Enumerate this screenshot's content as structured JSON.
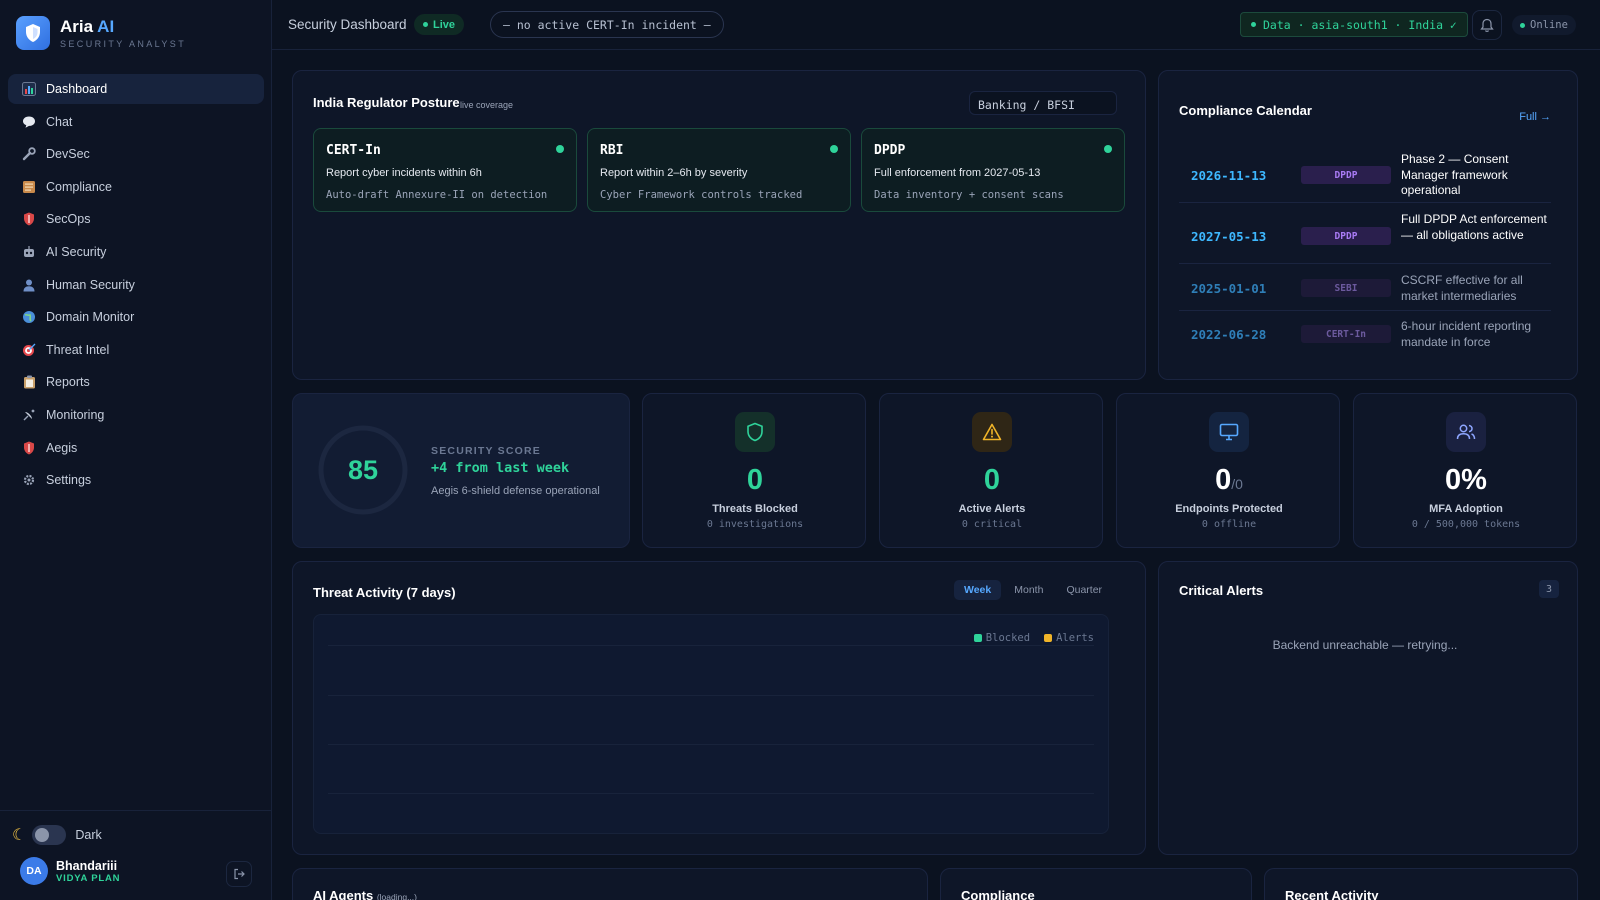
{
  "brand": {
    "name": "Aria",
    "name_accent": "AI",
    "subtitle": "SECURITY ANALYST"
  },
  "sidebar": {
    "items": [
      {
        "label": "Dashboard",
        "icon": "chart-icon",
        "active": true
      },
      {
        "label": "Chat",
        "icon": "speech-bubble-icon"
      },
      {
        "label": "DevSec",
        "icon": "wrench-icon"
      },
      {
        "label": "Compliance",
        "icon": "ledger-icon"
      },
      {
        "label": "SecOps",
        "icon": "shield-icon"
      },
      {
        "label": "AI Security",
        "icon": "robot-icon"
      },
      {
        "label": "Human Security",
        "icon": "person-icon"
      },
      {
        "label": "Domain Monitor",
        "icon": "globe-icon"
      },
      {
        "label": "Threat Intel",
        "icon": "target-icon"
      },
      {
        "label": "Reports",
        "icon": "clipboard-icon"
      },
      {
        "label": "Monitoring",
        "icon": "satellite-icon"
      },
      {
        "label": "Aegis",
        "icon": "shield-icon"
      },
      {
        "label": "Settings",
        "icon": "gear-icon"
      }
    ],
    "theme_label": "Dark",
    "user": {
      "initials": "DA",
      "name": "Bhandariii",
      "plan": "VIDYA PLAN"
    }
  },
  "topbar": {
    "title": "Security Dashboard",
    "live": "Live",
    "incident": "— no active CERT-In incident —",
    "region": "Data · asia-south1 · India ✓",
    "status": "Online"
  },
  "regulator": {
    "title": "India Regulator Posture",
    "subtitle": "live coverage",
    "sector": "Banking / BFSI",
    "tiles": [
      {
        "name": "CERT-In",
        "rule": "Report cyber incidents within 6h",
        "note": "Auto-draft Annexure-II on detection"
      },
      {
        "name": "RBI",
        "rule": "Report within 2–6h by severity",
        "note": "Cyber Framework controls tracked"
      },
      {
        "name": "DPDP",
        "rule": "Full enforcement from 2027-05-13",
        "note": "Data inventory + consent scans"
      }
    ]
  },
  "calendar": {
    "title": "Compliance Calendar",
    "full_link": "Full →",
    "rows": [
      {
        "date": "2026-11-13",
        "tag": "DPDP",
        "desc": "Phase 2 — Consent Manager framework operational",
        "upcoming": true
      },
      {
        "date": "2027-05-13",
        "tag": "DPDP",
        "desc": "Full DPDP Act enforcement — all obligations active",
        "upcoming": true
      },
      {
        "date": "2025-01-01",
        "tag": "SEBI",
        "desc": "CSCRF effective for all market intermediaries",
        "upcoming": false
      },
      {
        "date": "2022-06-28",
        "tag": "CERT-In",
        "desc": "6-hour incident reporting mandate in force",
        "upcoming": false
      }
    ]
  },
  "score": {
    "value": "85",
    "label": "SECURITY SCORE",
    "change": "+4 from last week",
    "note": "Aegis 6-shield defense operational",
    "fraction": 0.85
  },
  "stats": [
    {
      "value": "0",
      "label": "Threats Blocked",
      "sub": "0 investigations",
      "icon": "shield-check-icon",
      "color": "#2fd39a"
    },
    {
      "value": "0",
      "label": "Active Alerts",
      "sub": "0 critical",
      "icon": "warning-icon",
      "color": "#2fd39a"
    },
    {
      "value": "0",
      "denom": "/0",
      "label": "Endpoints Protected",
      "sub": "0 offline",
      "icon": "monitor-icon",
      "color": "#ffffff"
    },
    {
      "value": "0%",
      "label": "MFA Adoption",
      "sub": "0 / 500,000 tokens",
      "icon": "users-icon",
      "color": "#ffffff"
    }
  ],
  "threat": {
    "title": "Threat Activity (7 days)",
    "tabs": [
      "Week",
      "Month",
      "Quarter"
    ],
    "legend": [
      "Blocked",
      "Alerts"
    ]
  },
  "alerts": {
    "title": "Critical Alerts",
    "count": "3",
    "message": "Backend unreachable — retrying..."
  },
  "bottom": {
    "agents": "AI Agents",
    "agents_status": "(loading...)",
    "compliance": "Compliance",
    "activity": "Recent Activity"
  },
  "colors": {
    "accent": "#56a8ff",
    "success": "#2fd39a",
    "warning": "#f0b429",
    "dpdp_tag": "#8b5cf6",
    "muted": "#6b7892"
  }
}
